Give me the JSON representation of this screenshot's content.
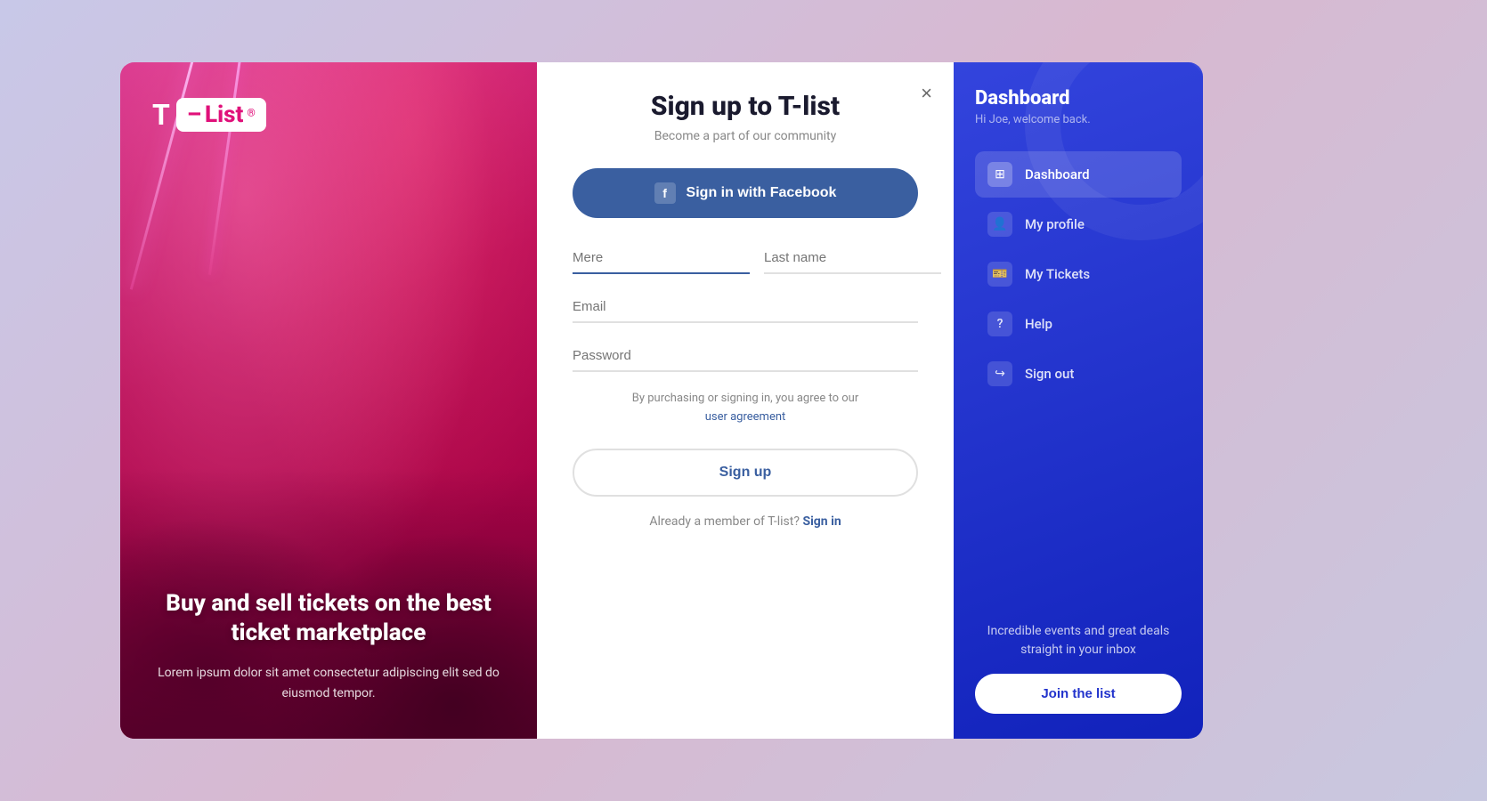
{
  "page": {
    "background_color": "#c8c8e0"
  },
  "left_panel": {
    "logo_t": "T",
    "logo_dash": "–",
    "logo_list": "List",
    "logo_registered": "®",
    "headline": "Buy and sell tickets on the best ticket marketplace",
    "description": "Lorem ipsum dolor sit amet consectetur adipiscing elit sed do eiusmod tempor."
  },
  "center_panel": {
    "close_label": "×",
    "title": "Sign up to T-list",
    "subtitle": "Become a part of our community",
    "facebook_btn_label": "Sign in with Facebook",
    "facebook_icon_letter": "f",
    "first_name_label": "Mere",
    "last_name_label": "Last name",
    "email_label": "Email",
    "password_label": "Password",
    "terms_text": "By purchasing or signing in, you agree to our",
    "terms_link_text": "user agreement",
    "signup_btn_label": "Sign up",
    "signin_prompt": "Already a member of T-list?",
    "signin_link_label": "Sign in"
  },
  "right_panel": {
    "title": "Dashboard",
    "welcome": "Hi Joe, welcome back.",
    "nav_items": [
      {
        "id": "dashboard",
        "label": "Dashboard",
        "icon": "⊞",
        "active": true
      },
      {
        "id": "my-profile",
        "label": "My profile",
        "icon": "○",
        "active": false
      },
      {
        "id": "my-tickets",
        "label": "My Tickets",
        "icon": "🎫",
        "active": false
      },
      {
        "id": "help",
        "label": "Help",
        "icon": "?",
        "active": false
      },
      {
        "id": "sign-out",
        "label": "Sign out",
        "icon": "→",
        "active": false
      }
    ],
    "newsletter_text": "Incredible events and great deals straight in your inbox",
    "join_btn_label": "Join the list"
  }
}
